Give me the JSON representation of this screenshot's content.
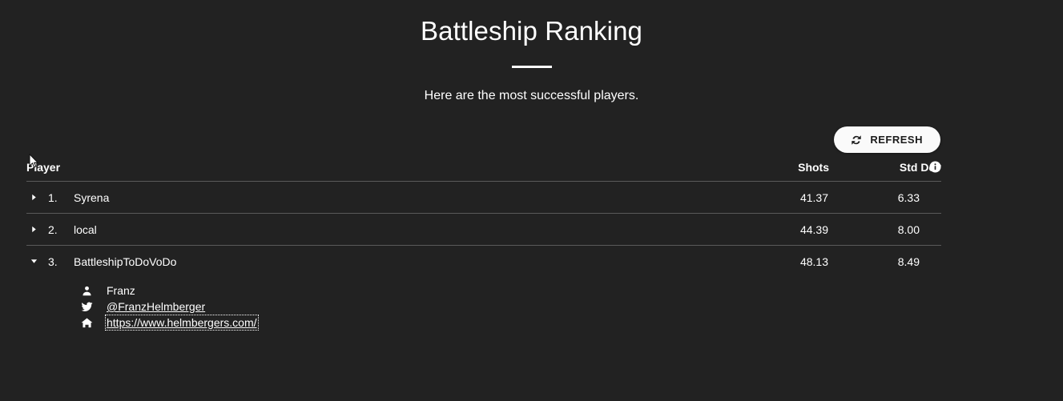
{
  "header": {
    "title": "Battleship Ranking",
    "subtitle": "Here are the most successful players."
  },
  "toolbar": {
    "refresh_label": "REFRESH",
    "refresh_icon": "sync-icon"
  },
  "table": {
    "columns": {
      "player": "Player",
      "shots": "Shots",
      "std_dev": "Std Dev"
    },
    "info_icon": "info-icon",
    "rows": [
      {
        "rank": "1.",
        "player": "Syrena",
        "shots": "41.37",
        "std_dev": "6.33",
        "expanded": false,
        "twisty_icon": "triangle-right-icon"
      },
      {
        "rank": "2.",
        "player": "local",
        "shots": "44.39",
        "std_dev": "8.00",
        "expanded": false,
        "twisty_icon": "triangle-right-icon"
      },
      {
        "rank": "3.",
        "player": "BattleshipToDoVoDo",
        "shots": "48.13",
        "std_dev": "8.49",
        "expanded": true,
        "twisty_icon": "triangle-down-icon"
      }
    ],
    "detail": {
      "name": {
        "icon": "user-icon",
        "text": "Franz"
      },
      "twitter": {
        "icon": "twitter-icon",
        "text": "@FranzHelmberger"
      },
      "website": {
        "icon": "home-icon",
        "text": "https://www.helmbergers.com/"
      }
    }
  },
  "colors": {
    "background": "#222222",
    "text": "#ffffff",
    "divider": "#5a5a5a",
    "button_bg": "#fafafa",
    "button_text": "#1b1b1b"
  },
  "cursor": {
    "icon": "mouse-pointer-icon"
  }
}
